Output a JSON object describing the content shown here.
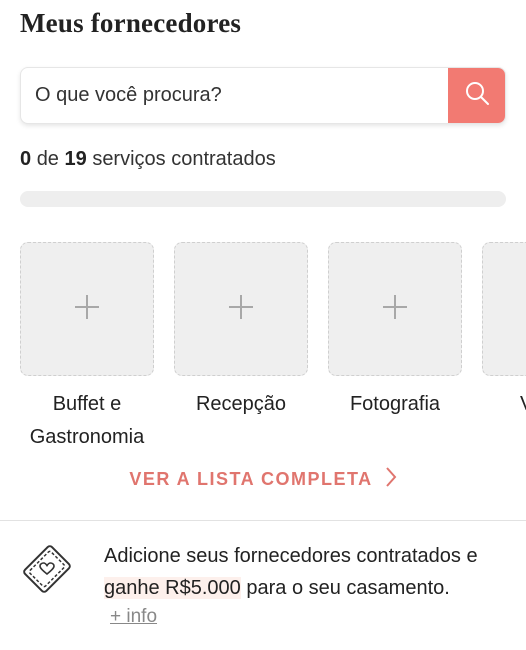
{
  "page": {
    "title": "Meus fornecedores"
  },
  "search": {
    "placeholder": "O que você procura?"
  },
  "summary": {
    "hired": "0",
    "connector": "de",
    "total": "19",
    "suffix": "serviços contratados",
    "progress_percent": 0
  },
  "categories": [
    {
      "label": "Buffet e Gastronomia"
    },
    {
      "label": "Recepção"
    },
    {
      "label": "Fotografia"
    },
    {
      "label": "V"
    }
  ],
  "list_link": {
    "label": "VER A LISTA COMPLETA"
  },
  "promo": {
    "text_before": "Adicione seus fornecedores contratados e",
    "highlight": "ganhe R$5.000",
    "text_after": "para o seu casamento.",
    "more_info": "+ info"
  },
  "colors": {
    "accent": "#f27a72",
    "link": "#e0756e"
  }
}
